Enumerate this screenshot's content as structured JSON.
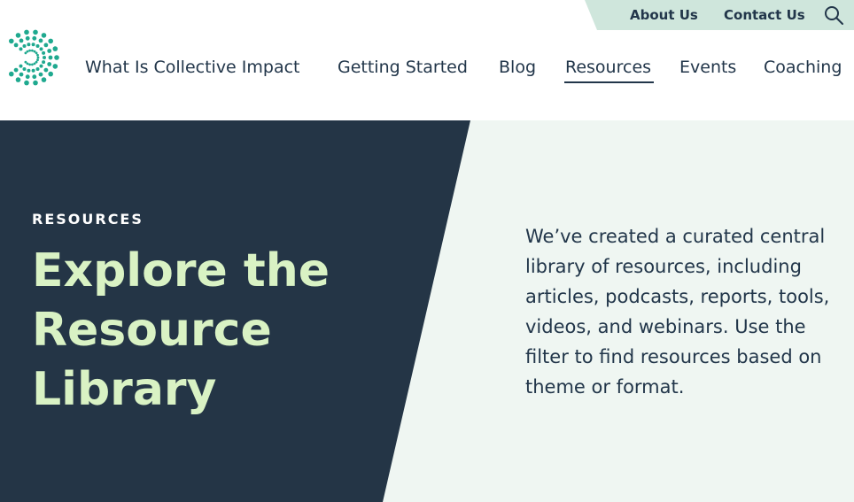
{
  "utility_nav": {
    "about": "About Us",
    "contact": "Contact Us",
    "search_icon": "search-icon"
  },
  "main_nav": {
    "items": [
      {
        "label": "What Is Collective Impact"
      },
      {
        "label": "Getting Started"
      },
      {
        "label": "Blog"
      },
      {
        "label": "Resources",
        "active": true
      },
      {
        "label": "Events"
      },
      {
        "label": "Coaching"
      }
    ]
  },
  "hero": {
    "eyebrow": "RESOURCES",
    "title": "Explore the Resource Library",
    "description": "We’ve created a curated central library of resources, including articles, podcasts, reports, tools, videos, and webinars. Use the filter to find resources based on theme or format."
  },
  "colors": {
    "brand_teal": "#1fa98f",
    "navy": "#243546",
    "mint_bar": "#cfe6dc",
    "hero_light": "#eff6f2",
    "title_green": "#d9f2c4"
  }
}
